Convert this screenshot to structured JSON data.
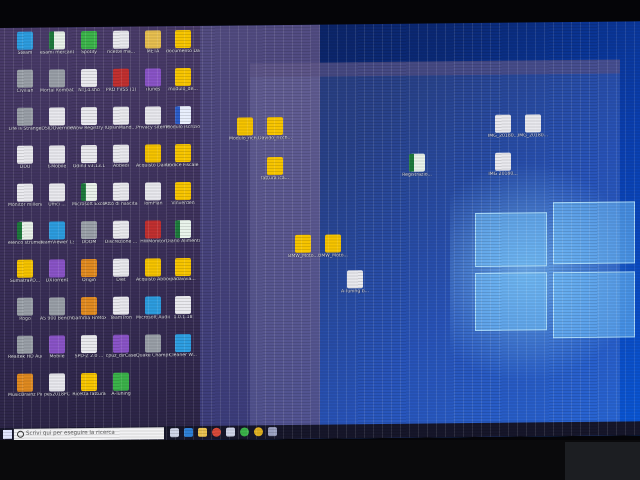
{
  "desktop": {
    "icons": [
      {
        "label": "Steam",
        "kind": "app2"
      },
      {
        "label": "esami mercantil.xlsx",
        "kind": "xls"
      },
      {
        "label": "Spotify",
        "kind": "app5"
      },
      {
        "label": "ricette ma...",
        "kind": "doc"
      },
      {
        "label": "META",
        "kind": "fld"
      },
      {
        "label": "documento Davide.pdf",
        "kind": "pdf"
      },
      {
        "label": "Civilian",
        "kind": "app6"
      },
      {
        "label": "Mortal Kombat X",
        "kind": "app6"
      },
      {
        "label": "NTJ.4.sho",
        "kind": "doc"
      },
      {
        "label": "PRO FVSS (1)",
        "kind": "app1"
      },
      {
        "label": "iTunes",
        "kind": "app3"
      },
      {
        "label": "modulo_de...",
        "kind": "pdf"
      },
      {
        "label": "Life is Strange",
        "kind": "app6"
      },
      {
        "label": "DSIDOverride",
        "kind": "doc"
      },
      {
        "label": "Wow Registry Cleaner",
        "kind": "doc"
      },
      {
        "label": "UpsinMand...",
        "kind": "doc"
      },
      {
        "label": "Privacy siteme",
        "kind": "doc"
      },
      {
        "label": "Modulo iscrizione",
        "kind": "wrd"
      },
      {
        "label": "DDU",
        "kind": "doc"
      },
      {
        "label": "t-Mobile",
        "kind": "doc"
      },
      {
        "label": "Odin3 v3.13.1",
        "kind": "doc"
      },
      {
        "label": "Abbedi",
        "kind": "doc"
      },
      {
        "label": "Acquisto Dainese V...",
        "kind": "pdf"
      },
      {
        "label": "Codice Fiscale D...",
        "kind": "pdf"
      },
      {
        "label": "Monitor millenager",
        "kind": "doc"
      },
      {
        "label": "Uffici ...",
        "kind": "doc"
      },
      {
        "label": "Microsoft Excel",
        "kind": "xls"
      },
      {
        "label": "Atto di nascita",
        "kind": "doc"
      },
      {
        "label": "TomPlan",
        "kind": "doc"
      },
      {
        "label": "Vinverden",
        "kind": "pdf"
      },
      {
        "label": "elenco strumenti...",
        "kind": "xls"
      },
      {
        "label": "TeamViewer 13",
        "kind": "app2"
      },
      {
        "label": "DOOM",
        "kind": "app6"
      },
      {
        "label": "Discrezione ...",
        "kind": "doc"
      },
      {
        "label": "HWMonitor",
        "kind": "app1"
      },
      {
        "label": "Diario Alimentare",
        "kind": "xls"
      },
      {
        "label": "SumatraPD...",
        "kind": "pdf"
      },
      {
        "label": "DXTorrent",
        "kind": "app3"
      },
      {
        "label": "Origin",
        "kind": "app4"
      },
      {
        "label": "Diet",
        "kind": "doc"
      },
      {
        "label": "Acquisto Abbonam...",
        "kind": "pdf"
      },
      {
        "label": "padavvia...",
        "kind": "pdf"
      },
      {
        "label": "Rogo",
        "kind": "app6"
      },
      {
        "label": "AS 900 Benchmark",
        "kind": "app6"
      },
      {
        "label": "Gamma Firefox",
        "kind": "app4"
      },
      {
        "label": "TeamTron",
        "kind": "doc"
      },
      {
        "label": "Microsoft Audio Ctrl",
        "kind": "app2"
      },
      {
        "label": "1.0.1.18",
        "kind": "doc"
      },
      {
        "label": "Realtek HD Audio Center",
        "kind": "app6"
      },
      {
        "label": "Mobile",
        "kind": "app3"
      },
      {
        "label": "SPD-Z 2.0 ...",
        "kind": "doc"
      },
      {
        "label": "cpuz_dirCase",
        "kind": "app3"
      },
      {
        "label": "Quake Champions",
        "kind": "app6"
      },
      {
        "label": "Cleaner W...",
        "kind": "app2"
      },
      {
        "label": "MusicBrainz Picard",
        "kind": "app4"
      },
      {
        "label": "pes2018PC",
        "kind": "doc"
      },
      {
        "label": "Ricetta fattura",
        "kind": "pdf"
      },
      {
        "label": "A-Tuning",
        "kind": "app5"
      }
    ],
    "right_icons": [
      {
        "label": "Modulo_rich...",
        "kind": "pdf"
      },
      {
        "label": "Davido_ricch...",
        "kind": "pdf"
      },
      {
        "label": "fattura ica...",
        "kind": "pdf"
      },
      {
        "label": "Registrazio...",
        "kind": "xls"
      },
      {
        "label": "IMG_20180...",
        "kind": "doc"
      },
      {
        "label": "IMG_20180...",
        "kind": "doc"
      },
      {
        "label": "IMG 20180...",
        "kind": "doc"
      },
      {
        "label": "BMW_Moto...",
        "kind": "pdf"
      },
      {
        "label": "BMW_Moto...",
        "kind": "pdf"
      },
      {
        "label": "A-Tuning b...",
        "kind": "doc"
      }
    ]
  },
  "taskbar": {
    "search_placeholder": "Scrivi qui per eseguire la ricerca"
  }
}
